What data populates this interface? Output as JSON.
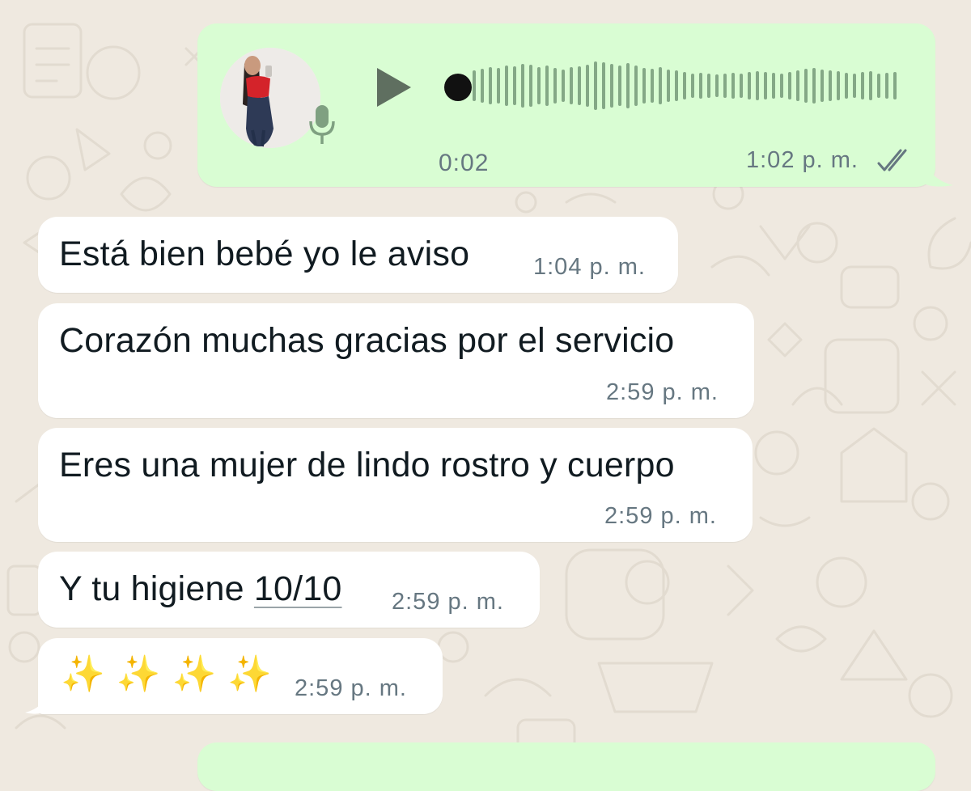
{
  "chat": {
    "voice_message": {
      "duration": "0:02",
      "time": "1:02 p. m.",
      "status_icon": "double-check-icon",
      "play_icon": "play-icon",
      "mic_icon": "microphone-icon",
      "progress": 0
    },
    "messages": [
      {
        "text": "Está bien bebé yo le aviso",
        "time": "1:04 p. m."
      },
      {
        "text": "Corazón muchas gracias por el servicio",
        "time": "2:59 p. m."
      },
      {
        "text": "Eres una mujer de lindo rostro y cuerpo",
        "time": "2:59 p. m."
      },
      {
        "text_prefix": "Y tu higiene ",
        "text_link": "10/10",
        "time": "2:59 p. m."
      },
      {
        "text": "✨✨✨✨",
        "time": "2:59 p. m."
      }
    ]
  },
  "colors": {
    "outgoing_bubble": "#d9fdd3",
    "incoming_bubble": "#ffffff",
    "background": "#efe9e0",
    "waveform": "#84a886",
    "time_text": "#667781"
  }
}
